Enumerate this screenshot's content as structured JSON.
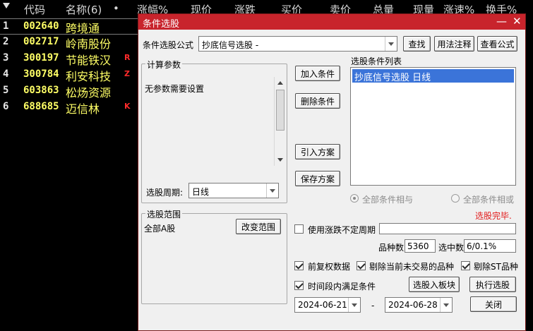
{
  "list": {
    "headers": [
      "代码",
      "名称(6)",
      "•",
      "涨幅%",
      "现价",
      "涨跌",
      "买价",
      "卖价",
      "总量",
      "现量",
      "涨速%",
      "换手%"
    ],
    "rows": [
      {
        "idx": "1",
        "code": "002640",
        "name": "跨境通",
        "tag": ""
      },
      {
        "idx": "2",
        "code": "002717",
        "name": "岭南股份",
        "tag": ""
      },
      {
        "idx": "3",
        "code": "300197",
        "name": "节能铁汉",
        "tag": "R"
      },
      {
        "idx": "4",
        "code": "300784",
        "name": "利安科技",
        "tag": "Z"
      },
      {
        "idx": "5",
        "code": "603863",
        "name": "松炀资源",
        "tag": ""
      },
      {
        "idx": "6",
        "code": "688685",
        "name": "迈信林",
        "tag": "K"
      }
    ]
  },
  "dialog": {
    "title": "条件选股",
    "minimize": "—",
    "close": "✕",
    "formula_label": "条件选股公式",
    "formula_value": "抄底信号选股 -",
    "find_button": "查找",
    "usage_button": "用法注释",
    "view_formula_button": "查看公式",
    "params_title": "计算参数",
    "params_text": "无参数需要设置",
    "period_label": "选股周期:",
    "period_value": "日线",
    "add_condition": "加入条件",
    "delete_condition": "删除条件",
    "import_plan": "引入方案",
    "save_plan": "保存方案",
    "conditions_title": "选股条件列表",
    "conditions": [
      "抄底信号选股  日线"
    ],
    "radio_and": "全部条件相与",
    "radio_or": "全部条件相或",
    "status": "选股完毕.",
    "range_title": "选股范围",
    "range_value": "全部A股",
    "change_range": "改变范围",
    "use_unsettled_label": "使用涨跌不定周期",
    "stock_count_label": "品种数",
    "stock_count_value": "5360",
    "selected_label": "选中数",
    "selected_value": "6/0.1%",
    "front_adjust": "前复权数据",
    "exclude_untraded": "剔除当前未交易的品种",
    "exclude_st": "剔除ST品种",
    "time_range": "时间段内满足条件",
    "to_board": "选股入板块",
    "execute": "执行选股",
    "date_from": "2024-06-21",
    "date_sep": "-",
    "date_to": "2024-06-28",
    "close_button": "关闭"
  }
}
